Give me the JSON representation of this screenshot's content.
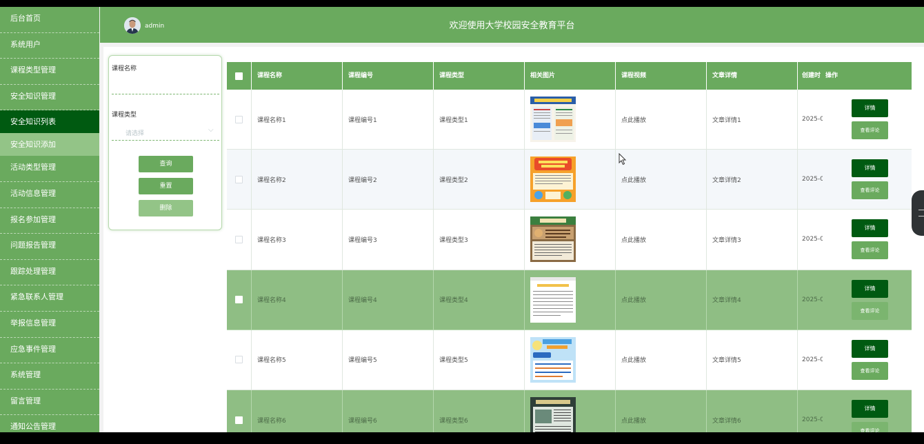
{
  "sidebar": {
    "items": [
      {
        "label": "后台首页"
      },
      {
        "label": "系统用户"
      },
      {
        "label": "课程类型管理"
      },
      {
        "label": "安全知识管理"
      },
      {
        "label": "安全知识列表"
      },
      {
        "label": "安全知识添加"
      },
      {
        "label": "活动类型管理"
      },
      {
        "label": "活动信息管理"
      },
      {
        "label": "报名参加管理"
      },
      {
        "label": "问题报告管理"
      },
      {
        "label": "跟踪处理管理"
      },
      {
        "label": "紧急联系人管理"
      },
      {
        "label": "举报信息管理"
      },
      {
        "label": "应急事件管理"
      },
      {
        "label": "系统管理"
      },
      {
        "label": "留言管理"
      },
      {
        "label": "通知公告管理"
      }
    ]
  },
  "header": {
    "user": "admin",
    "title": "欢迎使用大学校园安全教育平台"
  },
  "filter": {
    "course_name_label": "课程名称",
    "course_type_label": "课程类型",
    "select_placeholder": "请选择",
    "query_button": "查询",
    "reset_button": "重置",
    "delete_button": "删除"
  },
  "table": {
    "headers": [
      "课程名称",
      "课程编号",
      "课程类型",
      "相关图片",
      "课程视频",
      "文章详情",
      "创建时",
      "操作"
    ],
    "rows": [
      {
        "name": "课程名称1",
        "code": "课程编号1",
        "type": "课程类型1",
        "video": "点此播放",
        "article": "文章详情1",
        "created": "2025-0"
      },
      {
        "name": "课程名称2",
        "code": "课程编号2",
        "type": "课程类型2",
        "video": "点此播放",
        "article": "文章详情2",
        "created": "2025-0"
      },
      {
        "name": "课程名称3",
        "code": "课程编号3",
        "type": "课程类型3",
        "video": "点此播放",
        "article": "文章详情3",
        "created": "2025-0"
      },
      {
        "name": "课程名称4",
        "code": "课程编号4",
        "type": "课程类型4",
        "video": "点此播放",
        "article": "文章详情4",
        "created": "2025-0"
      },
      {
        "name": "课程名称5",
        "code": "课程编号5",
        "type": "课程类型5",
        "video": "点此播放",
        "article": "文章详情5",
        "created": "2025-0"
      },
      {
        "name": "课程名称6",
        "code": "课程编号6",
        "type": "课程类型6",
        "video": "点此播放",
        "article": "文章详情6",
        "created": "2025-0"
      }
    ],
    "detail_button": "详情",
    "review_button": "查看评论"
  },
  "colors": {
    "primary": "#6aaa5e",
    "dark": "#005a11",
    "light": "#93c487"
  }
}
